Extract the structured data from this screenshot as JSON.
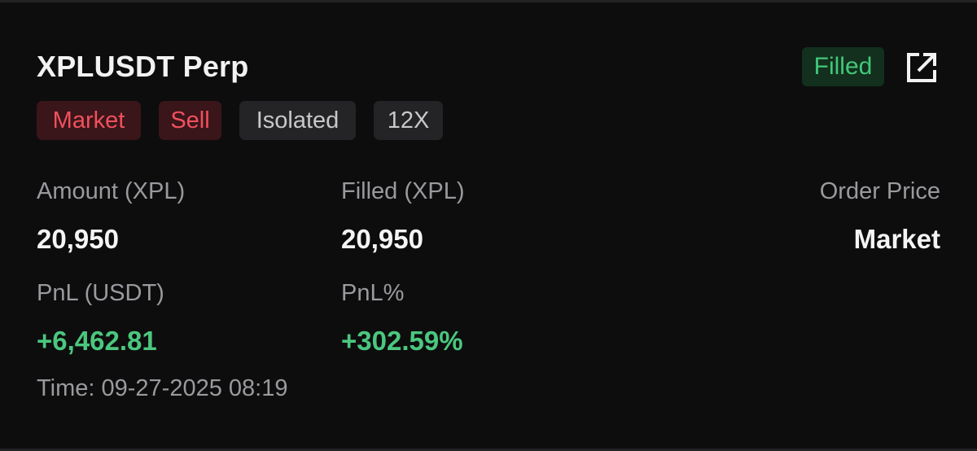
{
  "order": {
    "symbol": "XPLUSDT Perp",
    "status": "Filled",
    "tags": {
      "type": "Market",
      "side": "Sell",
      "margin_mode": "Isolated",
      "leverage": "12X"
    },
    "fields": {
      "amount_label": "Amount (XPL)",
      "amount_value": "20,950",
      "filled_label": "Filled (XPL)",
      "filled_value": "20,950",
      "price_label": "Order Price",
      "price_value": "Market",
      "pnl_label": "PnL (USDT)",
      "pnl_value": "+6,462.81",
      "pnl_pct_label": "PnL%",
      "pnl_pct_value": "+302.59%"
    },
    "time_label": "Time:",
    "time_value": "09-27-2025 08:19"
  },
  "icons": {
    "share": "share-external-icon"
  },
  "colors": {
    "background": "#0d0d0e",
    "positive": "#4bc77e",
    "negative": "#f0505e",
    "status_bg": "#12301d"
  }
}
